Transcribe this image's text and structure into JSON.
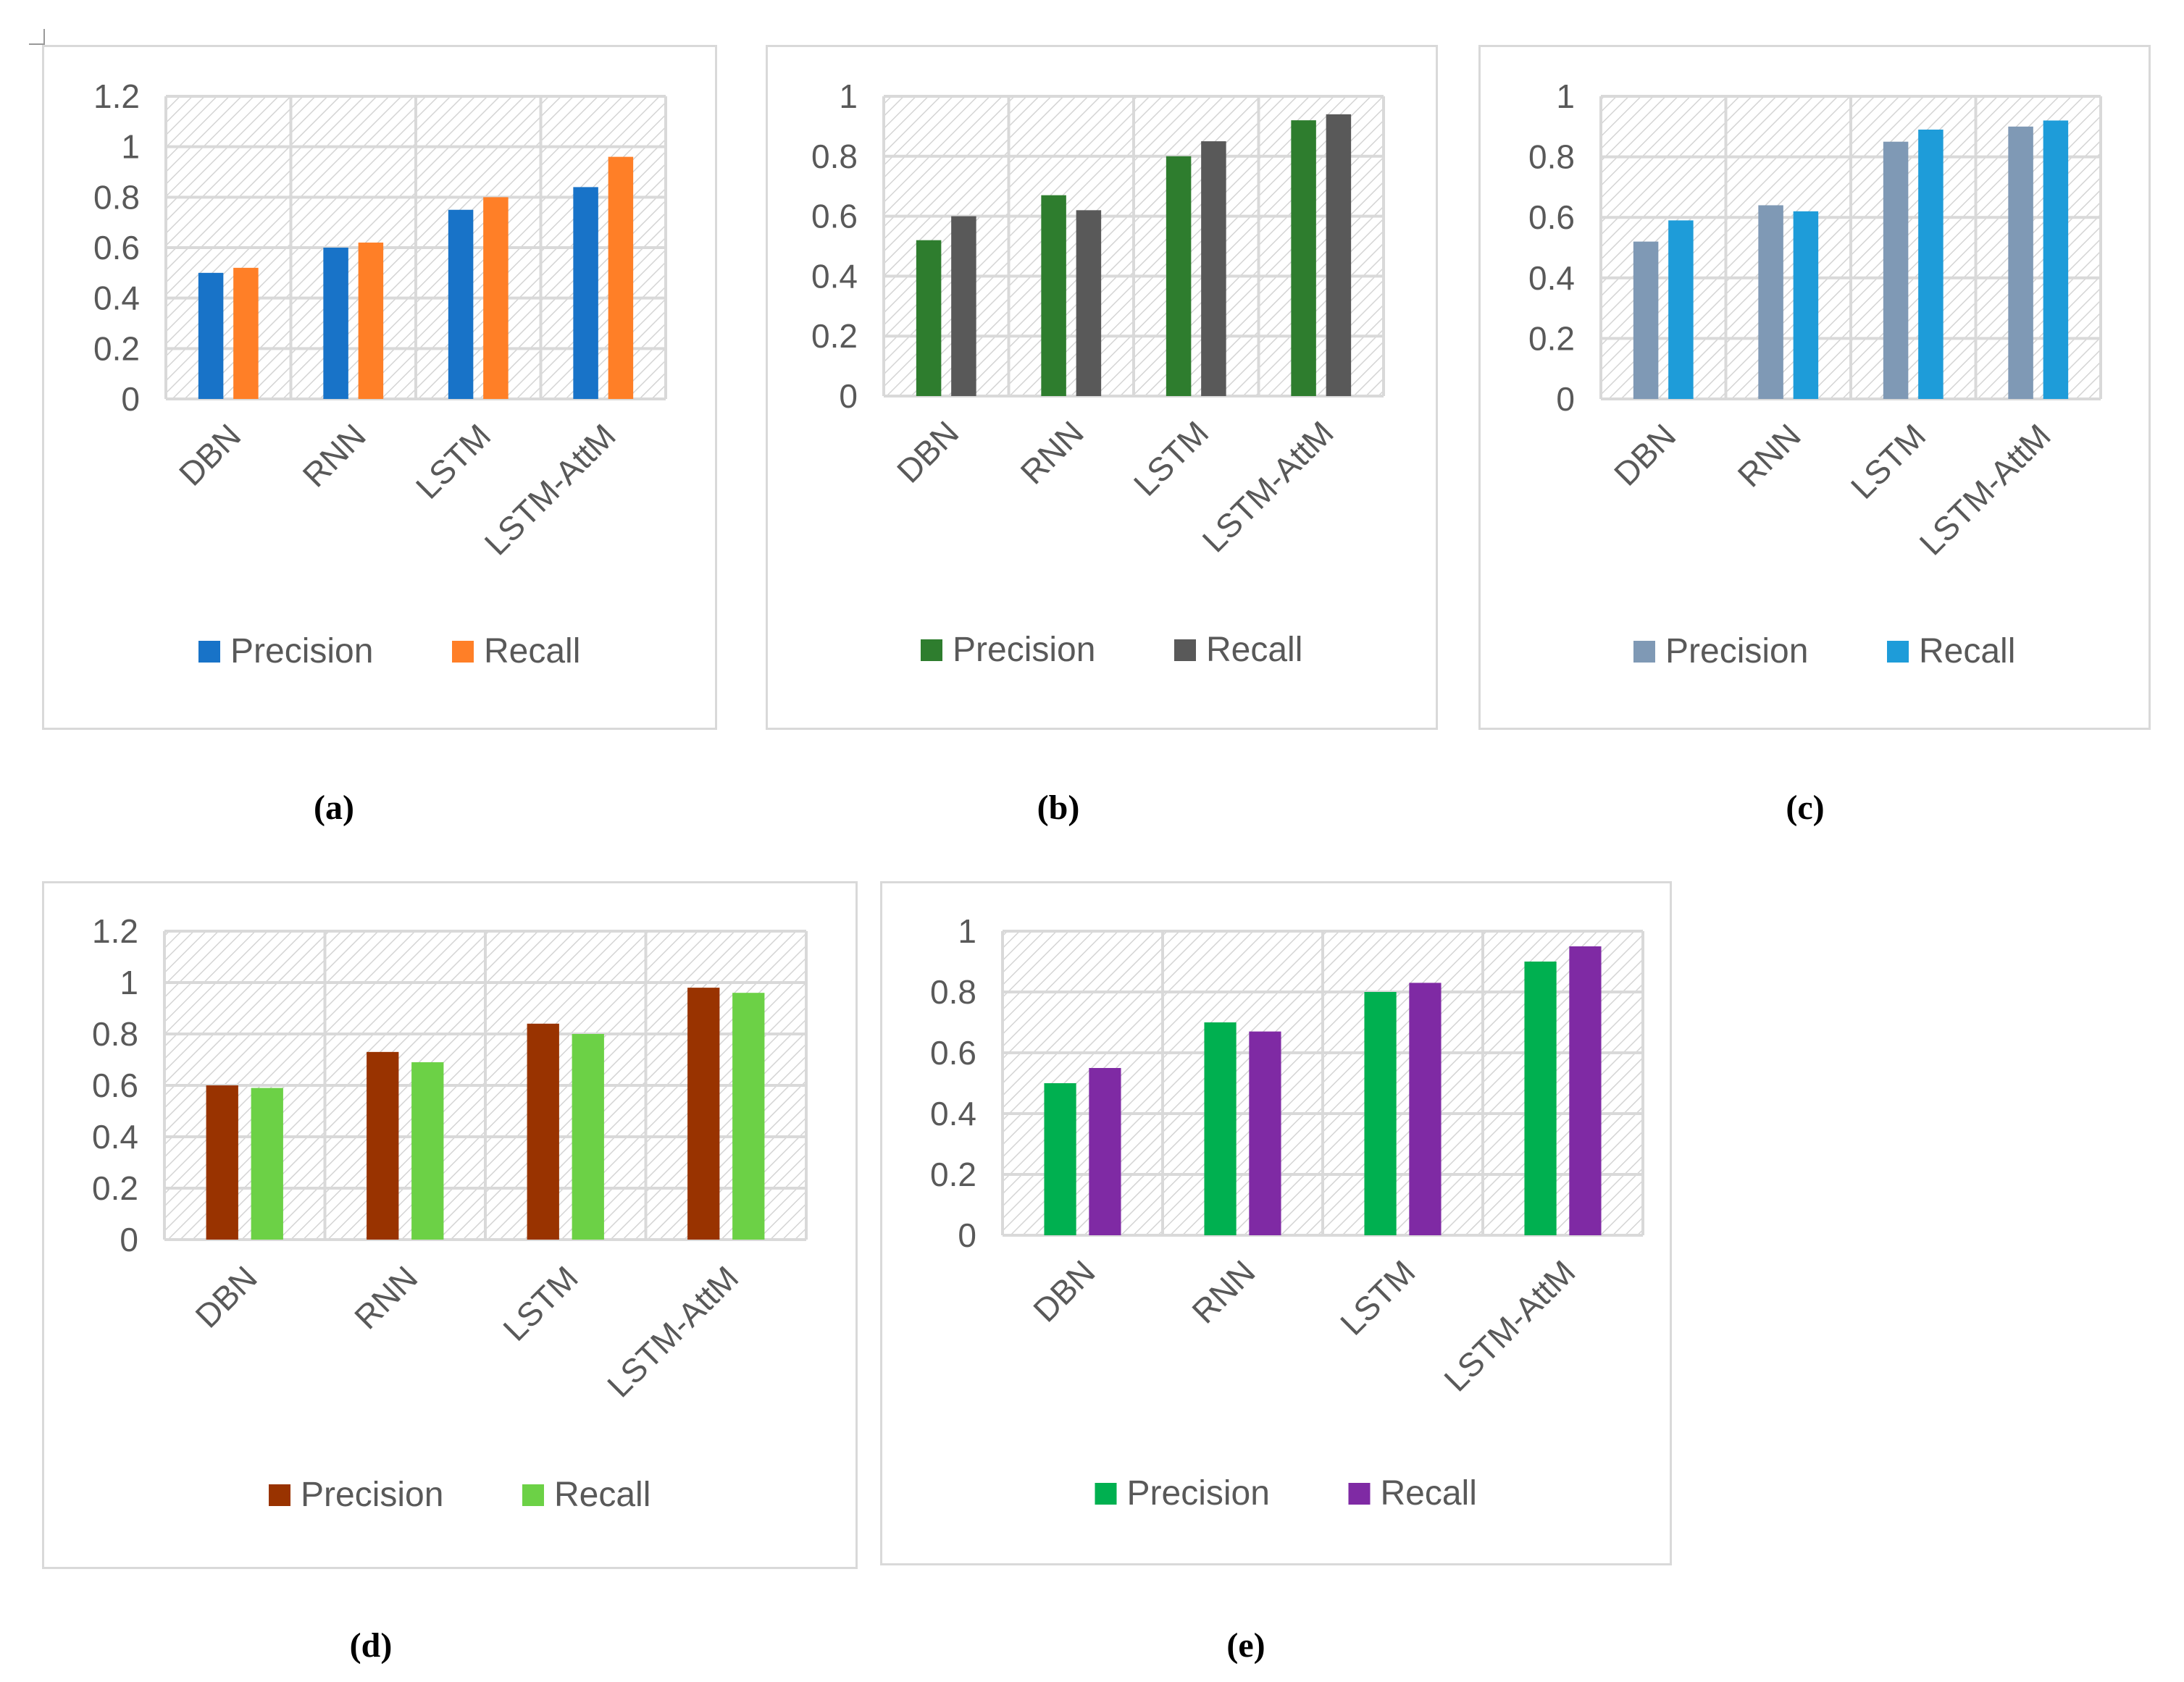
{
  "figure": {
    "captions": [
      "(a)",
      "(b)",
      "(c)",
      "(d)",
      "(e)"
    ]
  },
  "chart_data": [
    {
      "id": "a",
      "type": "bar",
      "title": "",
      "xlabel": "",
      "ylabel": "",
      "categories": [
        "DBN",
        "RNN",
        "LSTM",
        "LSTM-AttM"
      ],
      "series": [
        {
          "name": "Precision",
          "color": "#1873C8",
          "values": [
            0.5,
            0.6,
            0.75,
            0.84
          ]
        },
        {
          "name": "Recall",
          "color": "#FF7F27",
          "values": [
            0.52,
            0.62,
            0.8,
            0.96
          ]
        }
      ],
      "ylim": [
        0,
        1.2
      ],
      "yticks": [
        "0",
        "0.2",
        "0.4",
        "0.6",
        "0.8",
        "1",
        "1.2"
      ],
      "grid": true,
      "legend": "bottom",
      "caption": "(a)"
    },
    {
      "id": "b",
      "type": "bar",
      "title": "",
      "xlabel": "",
      "ylabel": "",
      "categories": [
        "DBN",
        "RNN",
        "LSTM",
        "LSTM-AttM"
      ],
      "series": [
        {
          "name": "Precision",
          "color": "#2E7D2E",
          "values": [
            0.52,
            0.67,
            0.8,
            0.92
          ]
        },
        {
          "name": "Recall",
          "color": "#595959",
          "values": [
            0.6,
            0.62,
            0.85,
            0.94
          ]
        }
      ],
      "ylim": [
        0,
        1
      ],
      "yticks": [
        "0",
        "0.2",
        "0.4",
        "0.6",
        "0.8",
        "1"
      ],
      "grid": true,
      "legend": "bottom",
      "caption": "(b)"
    },
    {
      "id": "c",
      "type": "bar",
      "title": "",
      "xlabel": "",
      "ylabel": "",
      "categories": [
        "DBN",
        "RNN",
        "LSTM",
        "LSTM-AttM"
      ],
      "series": [
        {
          "name": "Precision",
          "color": "#7F99B5",
          "values": [
            0.52,
            0.64,
            0.85,
            0.9
          ]
        },
        {
          "name": "Recall",
          "color": "#1E9CD9",
          "values": [
            0.59,
            0.62,
            0.89,
            0.92
          ]
        }
      ],
      "ylim": [
        0,
        1
      ],
      "yticks": [
        "0",
        "0.2",
        "0.4",
        "0.6",
        "0.8",
        "1"
      ],
      "grid": true,
      "legend": "bottom",
      "caption": "(c)"
    },
    {
      "id": "d",
      "type": "bar",
      "title": "",
      "xlabel": "",
      "ylabel": "",
      "categories": [
        "DBN",
        "RNN",
        "LSTM",
        "LSTM-AttM"
      ],
      "series": [
        {
          "name": "Precision",
          "color": "#993300",
          "values": [
            0.6,
            0.73,
            0.84,
            0.98
          ]
        },
        {
          "name": "Recall",
          "color": "#6CD146",
          "values": [
            0.59,
            0.69,
            0.8,
            0.96
          ]
        }
      ],
      "ylim": [
        0,
        1.2
      ],
      "yticks": [
        "0",
        "0.2",
        "0.4",
        "0.6",
        "0.8",
        "1",
        "1.2"
      ],
      "grid": true,
      "legend": "bottom",
      "caption": "(d)"
    },
    {
      "id": "e",
      "type": "bar",
      "title": "",
      "xlabel": "",
      "ylabel": "",
      "categories": [
        "DBN",
        "RNN",
        "LSTM",
        "LSTM-AttM"
      ],
      "series": [
        {
          "name": "Precision",
          "color": "#00B050",
          "values": [
            0.5,
            0.7,
            0.8,
            0.9
          ]
        },
        {
          "name": "Recall",
          "color": "#7F2AA4",
          "values": [
            0.55,
            0.67,
            0.83,
            0.95
          ]
        }
      ],
      "ylim": [
        0,
        1
      ],
      "yticks": [
        "0",
        "0.2",
        "0.4",
        "0.6",
        "0.8",
        "1"
      ],
      "grid": true,
      "legend": "bottom",
      "caption": "(e)"
    }
  ]
}
